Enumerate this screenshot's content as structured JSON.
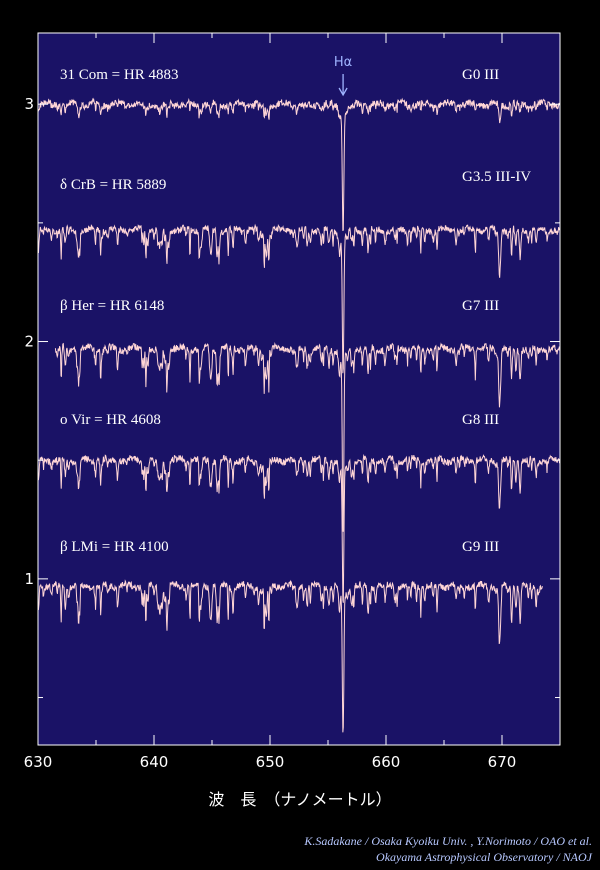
{
  "chart_data": {
    "type": "line",
    "title": "",
    "xlabel": "波　長　（ナノメートル）",
    "ylabel": "",
    "xlim": [
      630,
      675
    ],
    "ylim": [
      0.3,
      3.3
    ],
    "x_ticks": [
      630,
      640,
      650,
      660,
      670
    ],
    "y_ticks": [
      1,
      2,
      3
    ],
    "grid": false,
    "colors": {
      "background": "#000000",
      "plot_bg": "#1a1266",
      "line": "#ffd6d6",
      "axis": "#ffffff",
      "annotation": "#9fb4ff"
    },
    "annotation": {
      "label": "Hα",
      "x": 656.3,
      "y": 3.1
    },
    "series": [
      {
        "name": "31 Com = HR 4883",
        "spectral_type": "G0 III",
        "baseline": 3.0,
        "x_start": 630,
        "x_end": 675,
        "lines_depth": 0.35,
        "halpha_depth": 0.52
      },
      {
        "name": "δ CrB = HR 5889",
        "spectral_type": "G3.5 III-IV",
        "baseline": 2.47,
        "x_start": 630,
        "x_end": 675,
        "lines_depth": 0.9,
        "halpha_depth": 0.58
      },
      {
        "name": "β Her = HR 6148",
        "spectral_type": "G7 III",
        "baseline": 1.97,
        "x_start": 631.5,
        "x_end": 675,
        "lines_depth": 1.1,
        "halpha_depth": 0.75
      },
      {
        "name": "ο Vir = HR 4608",
        "spectral_type": "G8 III",
        "baseline": 1.5,
        "x_start": 630,
        "x_end": 675,
        "lines_depth": 0.95,
        "halpha_depth": 0.6
      },
      {
        "name": "β LMi = HR 4100",
        "spectral_type": "G9 III",
        "baseline": 0.97,
        "x_start": 630,
        "x_end": 673.5,
        "lines_depth": 1.2,
        "halpha_depth": 0.6
      }
    ]
  },
  "credits": {
    "line1": "K.Sadakane / Osaka Kyoiku Univ. , Y.Norimoto / OAO et al.",
    "line2": "Okayama Astrophysical Observatory / NAOJ"
  }
}
